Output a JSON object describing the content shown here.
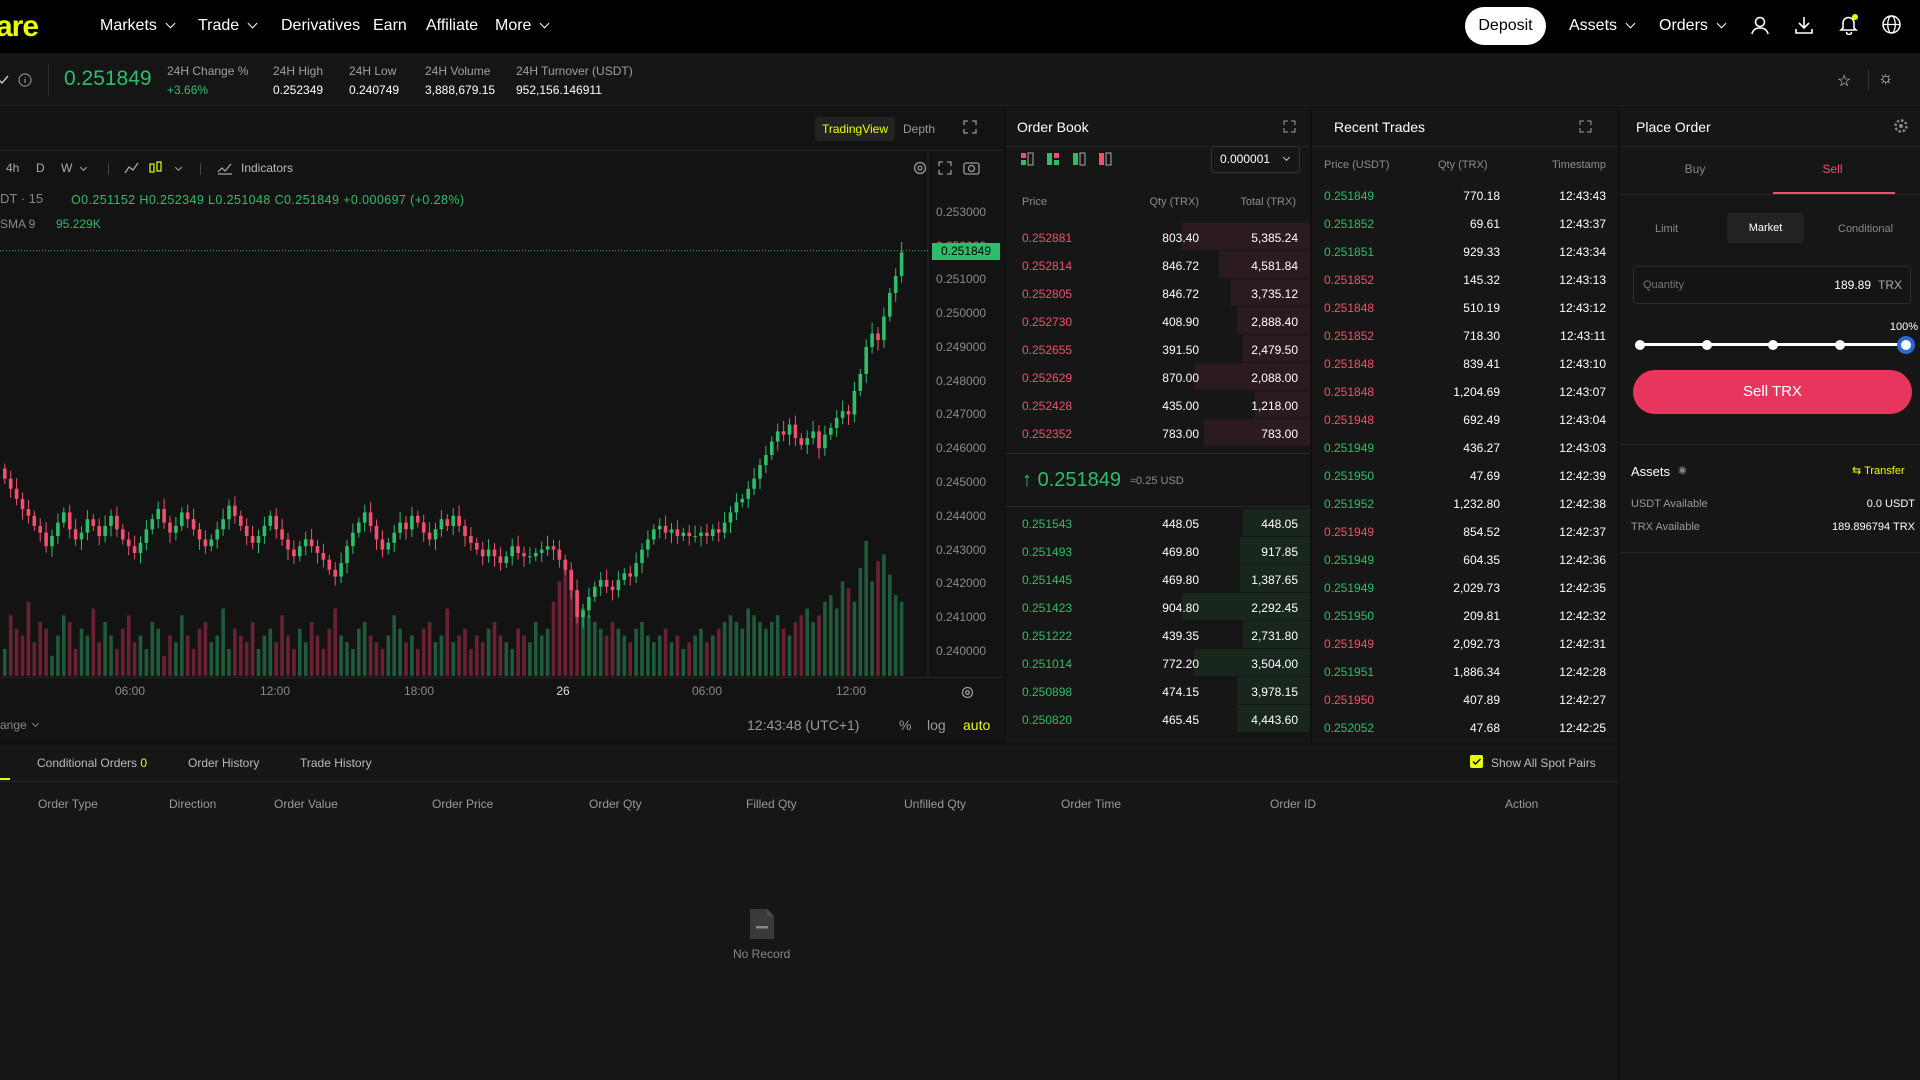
{
  "nav": {
    "logo": "are",
    "items": [
      "Markets",
      "Trade",
      "Derivatives",
      "Earn",
      "Affiliate",
      "More"
    ],
    "deposit": "Deposit",
    "assets": "Assets",
    "orders": "Orders"
  },
  "ticker": {
    "price": "0.251849",
    "change_label": "24H Change %",
    "change": "+3.66%",
    "high_label": "24H High",
    "high": "0.252349",
    "low_label": "24H Low",
    "low": "0.240749",
    "volume_label": "24H Volume",
    "volume": "3,888,679.15",
    "turnover_label": "24H Turnover (USDT)",
    "turnover": "952,156.146911"
  },
  "chart": {
    "tabs": [
      "TradingView",
      "Depth"
    ],
    "intervals": [
      "4h",
      "D",
      "W"
    ],
    "indicators": "Indicators",
    "symbol": "DT · 15",
    "ohlc": "O0.251152 H0.252349 L0.251048 C0.251849 +0.000697 (+0.28%)",
    "sma": "SMA 9",
    "sma_val": "95.229K",
    "last_price_tag": "0.251849",
    "y_ticks": [
      "0.253000",
      "0.252000",
      "0.251000",
      "0.250000",
      "0.249000",
      "0.248000",
      "0.247000",
      "0.246000",
      "0.245000",
      "0.244000",
      "0.243000",
      "0.242000",
      "0.241000",
      "0.240000"
    ],
    "x_ticks": [
      "06:00",
      "12:00",
      "18:00",
      "26",
      "06:00",
      "12:00"
    ],
    "time": "12:43:48 (UTC+1)",
    "scale_opts": [
      "%",
      "log",
      "auto"
    ],
    "range": "ange"
  },
  "chart_data": {
    "type": "candlestick",
    "ylim": [
      0.2397,
      0.2535
    ],
    "closes": [
      0.2451,
      0.2448,
      0.2445,
      0.2442,
      0.244,
      0.2437,
      0.2435,
      0.2431,
      0.2434,
      0.2438,
      0.2441,
      0.2436,
      0.2433,
      0.2435,
      0.2439,
      0.2437,
      0.2434,
      0.2437,
      0.244,
      0.2436,
      0.2433,
      0.2431,
      0.2429,
      0.2432,
      0.2436,
      0.2439,
      0.2442,
      0.2438,
      0.2435,
      0.2437,
      0.2441,
      0.2439,
      0.2436,
      0.2433,
      0.2431,
      0.2433,
      0.2436,
      0.2439,
      0.2443,
      0.244,
      0.2437,
      0.2434,
      0.2432,
      0.2434,
      0.2437,
      0.244,
      0.2436,
      0.2433,
      0.243,
      0.2428,
      0.2431,
      0.2433,
      0.2431,
      0.2429,
      0.2427,
      0.2424,
      0.2422,
      0.2426,
      0.2431,
      0.2435,
      0.2438,
      0.2441,
      0.2437,
      0.2433,
      0.243,
      0.2432,
      0.2435,
      0.2438,
      0.2436,
      0.244,
      0.2438,
      0.2435,
      0.2433,
      0.2436,
      0.2439,
      0.2437,
      0.244,
      0.2437,
      0.2434,
      0.2432,
      0.243,
      0.2428,
      0.243,
      0.2428,
      0.2426,
      0.2428,
      0.2431,
      0.2429,
      0.2428,
      0.2428,
      0.2429,
      0.243,
      0.2431,
      0.243,
      0.2427,
      0.2424,
      0.2418,
      0.241,
      0.2412,
      0.2416,
      0.2419,
      0.2421,
      0.2419,
      0.2418,
      0.2421,
      0.2423,
      0.2422,
      0.2426,
      0.243,
      0.2433,
      0.2436,
      0.2437,
      0.2435,
      0.2436,
      0.2434,
      0.2435,
      0.2434,
      0.2434,
      0.2435,
      0.2434,
      0.2436,
      0.2435,
      0.2438,
      0.2441,
      0.2444,
      0.2445,
      0.2448,
      0.2451,
      0.2455,
      0.2458,
      0.2462,
      0.2465,
      0.2464,
      0.2467,
      0.2463,
      0.2461,
      0.2463,
      0.2465,
      0.246,
      0.2464,
      0.2466,
      0.2469,
      0.2471,
      0.247,
      0.2477,
      0.2482,
      0.249,
      0.2494,
      0.2492,
      0.2499,
      0.2506,
      0.2511,
      0.2518
    ],
    "volumes": [
      0.2,
      0.45,
      0.35,
      0.3,
      0.55,
      0.25,
      0.4,
      0.35,
      0.15,
      0.3,
      0.45,
      0.4,
      0.2,
      0.35,
      0.3,
      0.5,
      0.25,
      0.4,
      0.3,
      0.2,
      0.35,
      0.45,
      0.25,
      0.3,
      0.2,
      0.4,
      0.35,
      0.15,
      0.3,
      0.25,
      0.45,
      0.3,
      0.2,
      0.35,
      0.4,
      0.25,
      0.3,
      0.5,
      0.2,
      0.35,
      0.3,
      0.25,
      0.4,
      0.2,
      0.3,
      0.35,
      0.25,
      0.45,
      0.3,
      0.2,
      0.35,
      0.25,
      0.4,
      0.3,
      0.2,
      0.35,
      0.5,
      0.3,
      0.25,
      0.2,
      0.35,
      0.4,
      0.3,
      0.25,
      0.2,
      0.3,
      0.45,
      0.35,
      0.25,
      0.3,
      0.2,
      0.35,
      0.4,
      0.25,
      0.3,
      0.5,
      0.25,
      0.3,
      0.35,
      0.2,
      0.3,
      0.25,
      0.35,
      0.4,
      0.3,
      0.25,
      0.2,
      0.35,
      0.3,
      0.25,
      0.4,
      0.3,
      0.35,
      0.55,
      0.7,
      0.85,
      0.75,
      0.6,
      0.5,
      0.45,
      0.4,
      0.35,
      0.3,
      0.4,
      0.35,
      0.3,
      0.25,
      0.35,
      0.4,
      0.3,
      0.25,
      0.3,
      0.35,
      0.25,
      0.3,
      0.2,
      0.25,
      0.3,
      0.35,
      0.25,
      0.3,
      0.35,
      0.4,
      0.45,
      0.4,
      0.35,
      0.5,
      0.45,
      0.4,
      0.35,
      0.4,
      0.45,
      0.35,
      0.3,
      0.4,
      0.45,
      0.5,
      0.4,
      0.45,
      0.55,
      0.6,
      0.5,
      0.7,
      0.65,
      0.55,
      0.8,
      1.0,
      0.7,
      0.85,
      0.9,
      0.75,
      0.6,
      0.55
    ]
  },
  "orderbook": {
    "title": "Order Book",
    "precision": "0.000001",
    "cols": [
      "Price",
      "Qty (TRX)",
      "Total (TRX)"
    ],
    "asks": [
      [
        "0.252881",
        "803.40",
        "5,385.24"
      ],
      [
        "0.252814",
        "846.72",
        "4,581.84"
      ],
      [
        "0.252805",
        "846.72",
        "3,735.12"
      ],
      [
        "0.252730",
        "408.90",
        "2,888.40"
      ],
      [
        "0.252655",
        "391.50",
        "2,479.50"
      ],
      [
        "0.252629",
        "870.00",
        "2,088.00"
      ],
      [
        "0.252428",
        "435.00",
        "1,218.00"
      ],
      [
        "0.252352",
        "783.00",
        "783.00"
      ]
    ],
    "ask_depth": [
      0.42,
      0.3,
      0.26,
      0.24,
      0.22,
      0.38,
      0.18,
      0.35
    ],
    "mid_price": "0.251849",
    "mid_usd": "≈0.25 USD",
    "bids": [
      [
        "0.251543",
        "448.05",
        "448.05"
      ],
      [
        "0.251493",
        "469.80",
        "917.85"
      ],
      [
        "0.251445",
        "469.80",
        "1,387.65"
      ],
      [
        "0.251423",
        "904.80",
        "2,292.45"
      ],
      [
        "0.251222",
        "439.35",
        "2,731.80"
      ],
      [
        "0.251014",
        "772.20",
        "3,504.00"
      ],
      [
        "0.250898",
        "474.15",
        "3,978.15"
      ],
      [
        "0.250820",
        "465.45",
        "4,443.60"
      ]
    ],
    "bid_depth": [
      0.22,
      0.23,
      0.23,
      0.42,
      0.22,
      0.38,
      0.24,
      0.24
    ]
  },
  "trades": {
    "title": "Recent Trades",
    "cols": [
      "Price (USDT)",
      "Qty (TRX)",
      "Timestamp"
    ],
    "rows": [
      [
        "0.251849",
        "770.18",
        "12:43:43",
        "g"
      ],
      [
        "0.251852",
        "69.61",
        "12:43:37",
        "g"
      ],
      [
        "0.251851",
        "929.33",
        "12:43:34",
        "g"
      ],
      [
        "0.251852",
        "145.32",
        "12:43:13",
        "r"
      ],
      [
        "0.251848",
        "510.19",
        "12:43:12",
        "r"
      ],
      [
        "0.251852",
        "718.30",
        "12:43:11",
        "r"
      ],
      [
        "0.251848",
        "839.41",
        "12:43:10",
        "r"
      ],
      [
        "0.251848",
        "1,204.69",
        "12:43:07",
        "r"
      ],
      [
        "0.251948",
        "692.49",
        "12:43:04",
        "r"
      ],
      [
        "0.251949",
        "436.27",
        "12:43:03",
        "g"
      ],
      [
        "0.251950",
        "47.69",
        "12:42:39",
        "g"
      ],
      [
        "0.251952",
        "1,232.80",
        "12:42:38",
        "g"
      ],
      [
        "0.251949",
        "854.52",
        "12:42:37",
        "r"
      ],
      [
        "0.251949",
        "604.35",
        "12:42:36",
        "g"
      ],
      [
        "0.251949",
        "2,029.73",
        "12:42:35",
        "g"
      ],
      [
        "0.251950",
        "209.81",
        "12:42:32",
        "g"
      ],
      [
        "0.251949",
        "2,092.73",
        "12:42:31",
        "r"
      ],
      [
        "0.251951",
        "1,886.34",
        "12:42:28",
        "g"
      ],
      [
        "0.251950",
        "407.89",
        "12:42:27",
        "r"
      ],
      [
        "0.252052",
        "47.68",
        "12:42:25",
        "g"
      ]
    ]
  },
  "place": {
    "title": "Place Order",
    "buy": "Buy",
    "sell": "Sell",
    "types": [
      "Limit",
      "Market",
      "Conditional"
    ],
    "qty_label": "Quantity",
    "qty_value": "189.89",
    "qty_unit": "TRX",
    "percent": "100%",
    "slider_fraction": 1.0,
    "submit": "Sell TRX",
    "assets_title": "Assets",
    "transfer": "Transfer",
    "usdt_label": "USDT Available",
    "usdt_val": "0.0 USDT",
    "trx_label": "TRX Available",
    "trx_val": "189.896794 TRX"
  },
  "orders": {
    "tabs": [
      "Conditional Orders",
      "Order History",
      "Trade History"
    ],
    "cond_count": "0",
    "show_all": "Show All Spot Pairs",
    "cols": [
      "Order Type",
      "Direction",
      "Order Value",
      "Order Price",
      "Order Qty",
      "Filled Qty",
      "Unfilled Qty",
      "Order Time",
      "Order ID",
      "Action"
    ],
    "empty": "No Record"
  },
  "colors": {
    "accent": "#e9ff00",
    "green": "#2ebd6b",
    "red": "#f0506e",
    "sell_btn": "#e8355d"
  }
}
